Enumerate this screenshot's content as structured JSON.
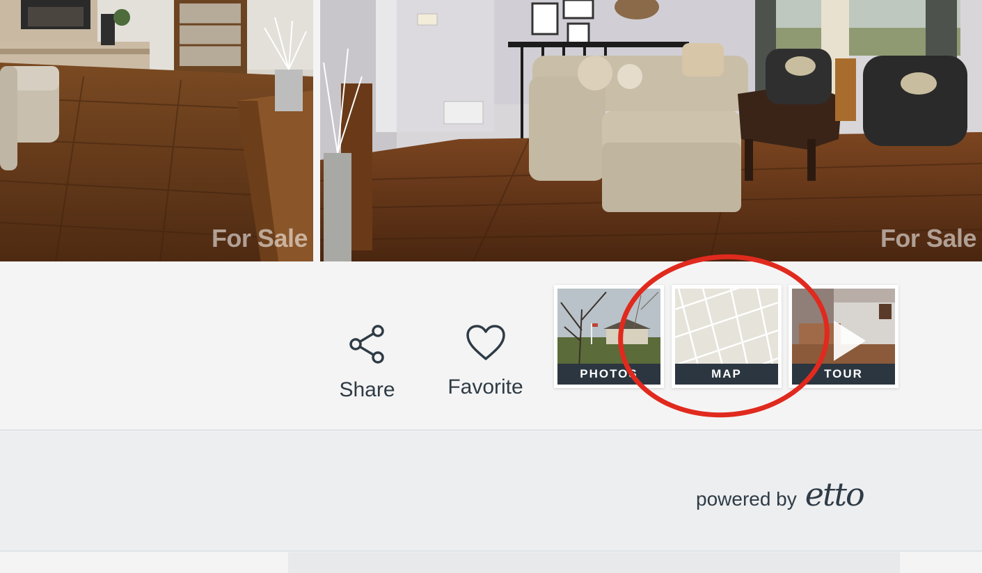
{
  "gallery": {
    "watermark_left": "For Sale",
    "watermark_right": "For Sale"
  },
  "actions": {
    "share_label": "Share",
    "share_icon": "share-icon",
    "favorite_label": "Favorite",
    "favorite_icon": "heart-icon"
  },
  "media_tabs": [
    {
      "label": "PHOTOS",
      "thumbnail": "house-exterior"
    },
    {
      "label": "MAP",
      "thumbnail": "map-preview"
    },
    {
      "label": "TOUR",
      "thumbnail": "interior-video",
      "icon": "play-icon"
    }
  ],
  "footer": {
    "powered_by": "powered by",
    "brand": "etto"
  },
  "colors": {
    "highlight": "#e02a1e",
    "text": "#2f3b45",
    "tab_label_bg": "#2b3640"
  }
}
